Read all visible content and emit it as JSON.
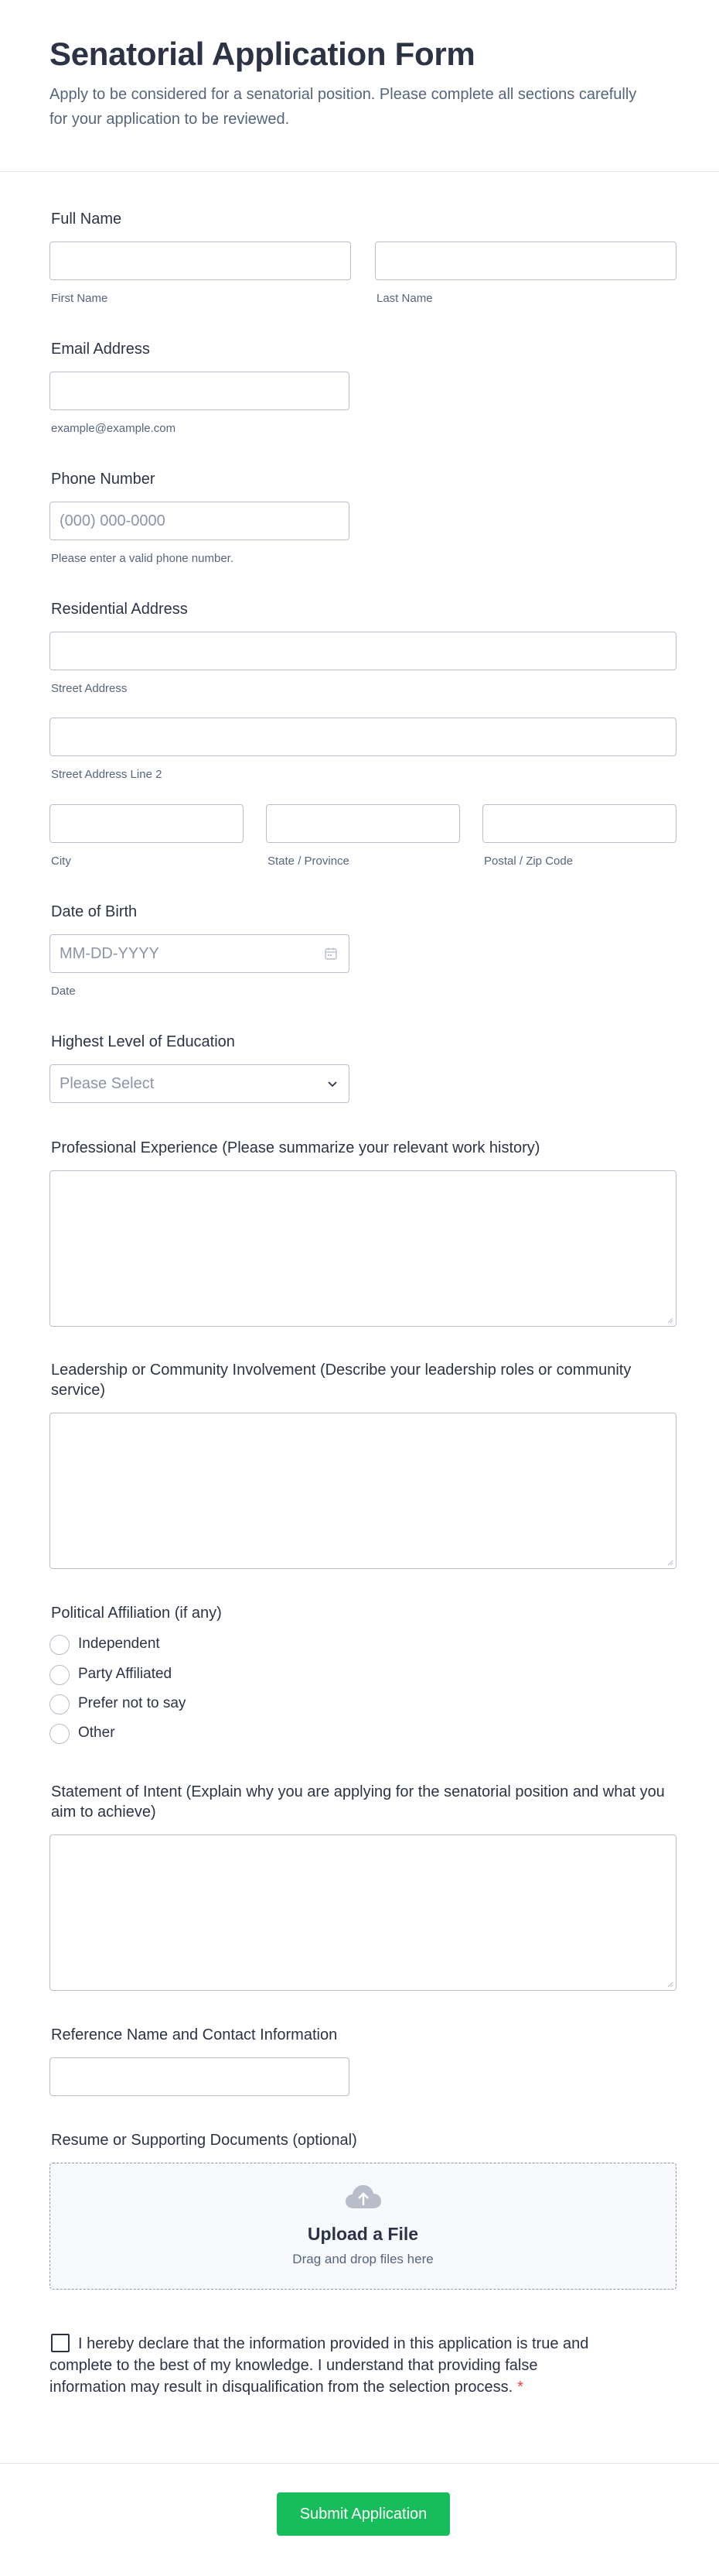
{
  "header": {
    "title": "Senatorial Application Form",
    "subtitle": "Apply to be considered for a senatorial position. Please complete all sections carefully for your application to be reviewed."
  },
  "full_name": {
    "label": "Full Name",
    "first_sublabel": "First Name",
    "last_sublabel": "Last Name"
  },
  "email": {
    "label": "Email Address",
    "sublabel": "example@example.com"
  },
  "phone": {
    "label": "Phone Number",
    "placeholder": "(000) 000-0000",
    "sublabel": "Please enter a valid phone number."
  },
  "address": {
    "label": "Residential Address",
    "street_sublabel": "Street Address",
    "street2_sublabel": "Street Address Line 2",
    "city_sublabel": "City",
    "state_sublabel": "State / Province",
    "zip_sublabel": "Postal / Zip Code"
  },
  "dob": {
    "label": "Date of Birth",
    "placeholder": "MM-DD-YYYY",
    "sublabel": "Date",
    "icon": "calendar-icon"
  },
  "education": {
    "label": "Highest Level of Education",
    "placeholder": "Please Select",
    "icon": "chevron-down-icon"
  },
  "experience": {
    "label": "Professional Experience (Please summarize your relevant work history)"
  },
  "leadership": {
    "label": "Leadership or Community Involvement (Describe your leadership roles or community service)"
  },
  "affiliation": {
    "label": "Political Affiliation (if any)",
    "options": [
      "Independent",
      "Party Affiliated",
      "Prefer not to say",
      "Other"
    ]
  },
  "statement": {
    "label": "Statement of Intent (Explain why you are applying for the senatorial position and what you aim to achieve)"
  },
  "reference": {
    "label": "Reference Name and Contact Information"
  },
  "resume": {
    "label": "Resume or Supporting Documents (optional)",
    "upload_title": "Upload a File",
    "upload_sub": "Drag and drop files here",
    "icon": "cloud-upload-icon"
  },
  "declaration": {
    "text": "I hereby declare that the information provided in this application is true and complete to the best of my knowledge. I understand that providing false information may result in disqualification from the selection process.",
    "required_mark": "*"
  },
  "submit": {
    "label": "Submit Application"
  },
  "colors": {
    "accent": "#18bd5b",
    "required": "#f23a3c",
    "text": "#2c3345",
    "sublabel": "#57647e",
    "border": "#b8bdc9"
  }
}
